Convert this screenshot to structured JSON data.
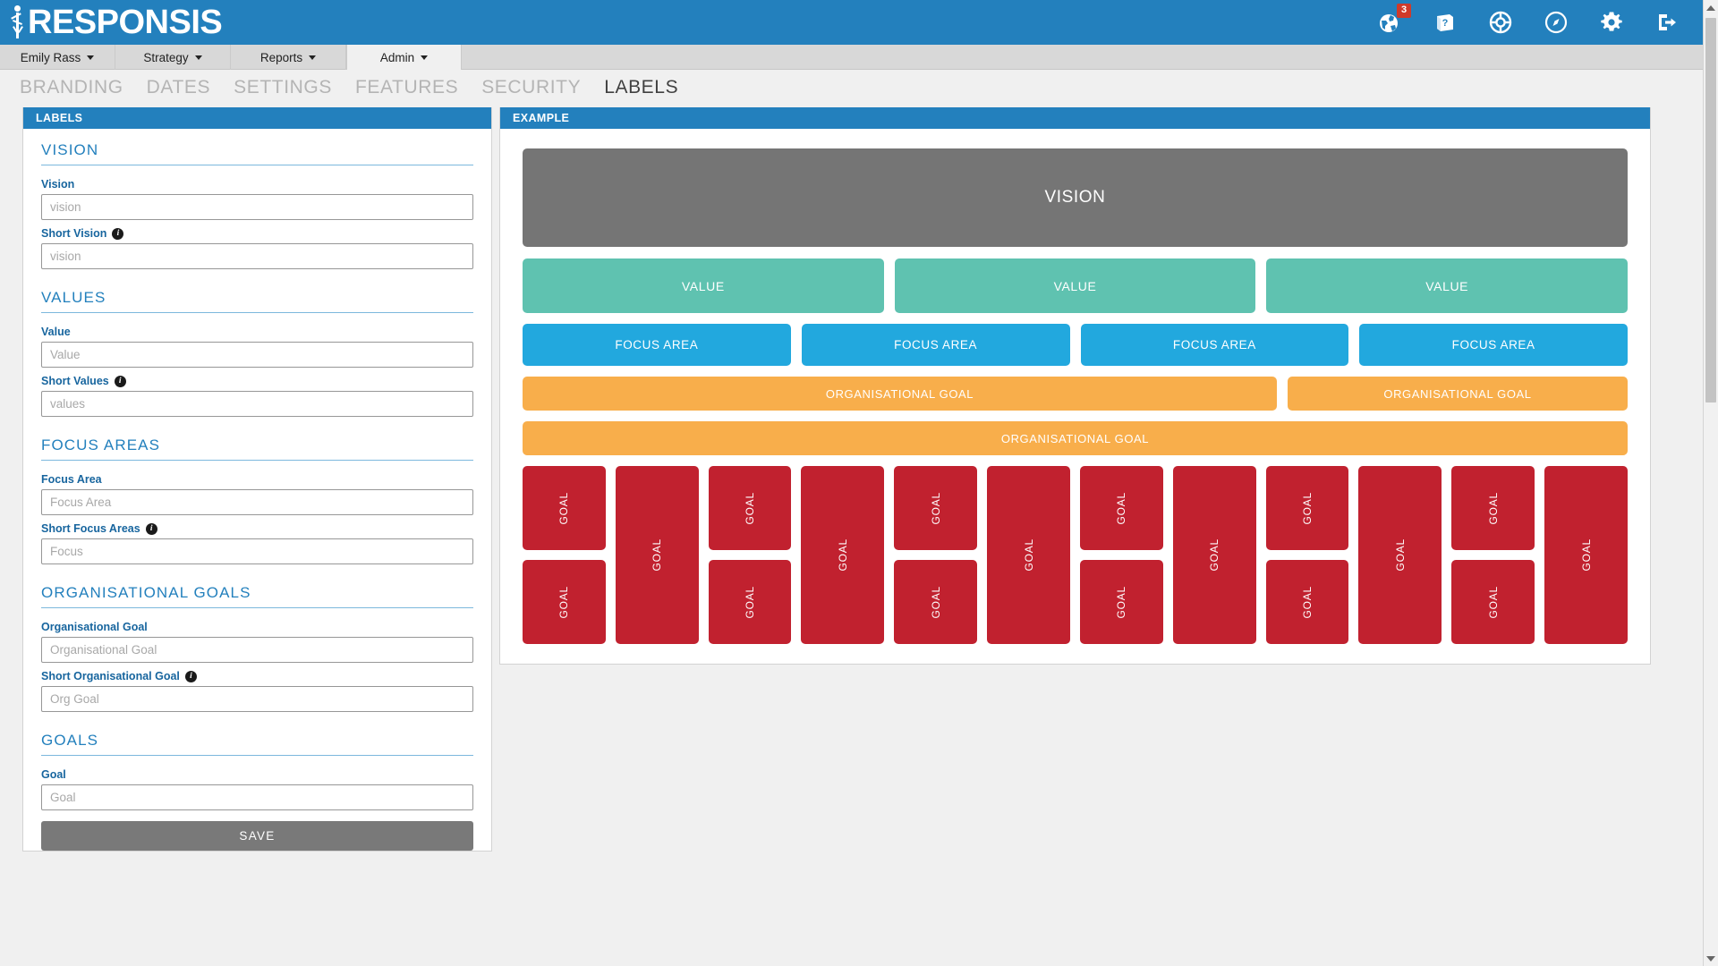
{
  "brand": {
    "name": "RESPONSIS",
    "logo_icon": "person-figure-icon",
    "bar_color": "#2380bd"
  },
  "topbar": {
    "icons": [
      {
        "name": "notifications-globe-icon",
        "badge": "3"
      },
      {
        "name": "help-book-icon",
        "badge": ""
      },
      {
        "name": "lifebuoy-support-icon",
        "badge": ""
      },
      {
        "name": "compass-icon",
        "badge": ""
      },
      {
        "name": "gear-settings-icon",
        "badge": ""
      },
      {
        "name": "logout-icon",
        "badge": ""
      }
    ],
    "badge_color": "#cf3a2a"
  },
  "nav": {
    "tabs": [
      {
        "label": "Emily Rass",
        "active": false,
        "has_caret": true
      },
      {
        "label": "Strategy",
        "active": false,
        "has_caret": true
      },
      {
        "label": "Reports",
        "active": false,
        "has_caret": true
      },
      {
        "label": "Admin",
        "active": true,
        "has_caret": true
      }
    ]
  },
  "subnav": {
    "tabs": [
      {
        "label": "BRANDING",
        "active": false
      },
      {
        "label": "DATES",
        "active": false
      },
      {
        "label": "SETTINGS",
        "active": false
      },
      {
        "label": "FEATURES",
        "active": false
      },
      {
        "label": "SECURITY",
        "active": false
      },
      {
        "label": "LABELS",
        "active": true
      }
    ]
  },
  "labels_panel": {
    "header": "LABELS",
    "sections": [
      {
        "title": "VISION",
        "fields": [
          {
            "label": "Vision",
            "value": "",
            "placeholder": "vision",
            "info": false
          },
          {
            "label": "Short Vision",
            "value": "",
            "placeholder": "vision",
            "info": true
          }
        ]
      },
      {
        "title": "VALUES",
        "fields": [
          {
            "label": "Value",
            "value": "",
            "placeholder": "Value",
            "info": false
          },
          {
            "label": "Short Values",
            "value": "",
            "placeholder": "values",
            "info": true
          }
        ]
      },
      {
        "title": "FOCUS AREAS",
        "fields": [
          {
            "label": "Focus Area",
            "value": "",
            "placeholder": "Focus Area",
            "info": false
          },
          {
            "label": "Short Focus Areas",
            "value": "",
            "placeholder": "Focus",
            "info": true
          }
        ]
      },
      {
        "title": "ORGANISATIONAL GOALS",
        "fields": [
          {
            "label": "Organisational Goal",
            "value": "",
            "placeholder": "Organisational Goal",
            "info": false
          },
          {
            "label": "Short Organisational Goal",
            "value": "",
            "placeholder": "Org Goal",
            "info": true
          }
        ]
      },
      {
        "title": "GOALS",
        "fields": [
          {
            "label": "Goal",
            "value": "",
            "placeholder": "Goal",
            "info": false
          }
        ]
      }
    ],
    "save_label": "SAVE",
    "info_glyph": "i"
  },
  "example_panel": {
    "header": "EXAMPLE",
    "vision": {
      "label": "VISION",
      "color": "#757575"
    },
    "values": {
      "color": "#5fc2b0",
      "items": [
        "VALUE",
        "VALUE",
        "VALUE"
      ]
    },
    "focus_areas": {
      "color": "#22a8de",
      "items": [
        "FOCUS AREA",
        "FOCUS AREA",
        "FOCUS AREA",
        "FOCUS AREA"
      ]
    },
    "org_goals": {
      "color": "#f8ae4b",
      "row1": [
        "ORGANISATIONAL GOAL",
        "ORGANISATIONAL GOAL"
      ],
      "row2": [
        "ORGANISATIONAL GOAL"
      ]
    },
    "goals": {
      "color": "#c1212f",
      "label": "GOAL",
      "columns": [
        {
          "type": "split",
          "items": [
            "GOAL",
            "GOAL"
          ]
        },
        {
          "type": "tall",
          "items": [
            "GOAL"
          ]
        },
        {
          "type": "split",
          "items": [
            "GOAL",
            "GOAL"
          ]
        },
        {
          "type": "tall",
          "items": [
            "GOAL"
          ]
        },
        {
          "type": "split",
          "items": [
            "GOAL",
            "GOAL"
          ]
        },
        {
          "type": "tall",
          "items": [
            "GOAL"
          ]
        },
        {
          "type": "split",
          "items": [
            "GOAL",
            "GOAL"
          ]
        },
        {
          "type": "tall",
          "items": [
            "GOAL"
          ]
        },
        {
          "type": "split",
          "items": [
            "GOAL",
            "GOAL"
          ]
        },
        {
          "type": "tall",
          "items": [
            "GOAL"
          ]
        },
        {
          "type": "split",
          "items": [
            "GOAL",
            "GOAL"
          ]
        },
        {
          "type": "tall",
          "items": [
            "GOAL"
          ]
        }
      ]
    }
  }
}
